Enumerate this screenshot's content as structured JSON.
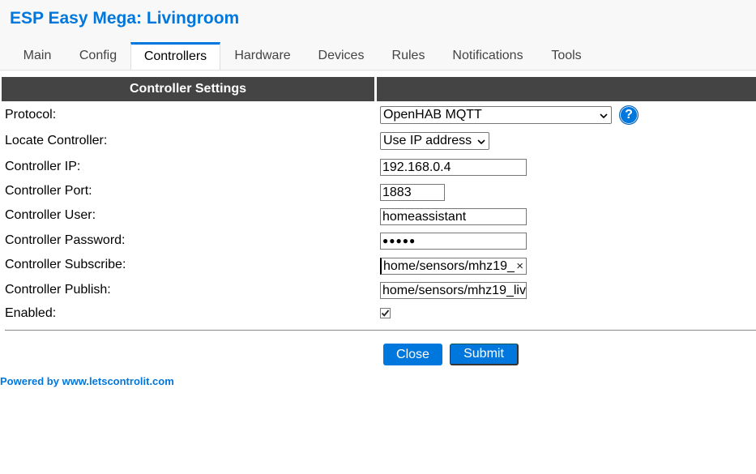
{
  "app": {
    "title": "ESP Easy Mega: Livingroom"
  },
  "tabs": [
    {
      "label": "Main"
    },
    {
      "label": "Config"
    },
    {
      "label": "Controllers",
      "active": true
    },
    {
      "label": "Hardware"
    },
    {
      "label": "Devices"
    },
    {
      "label": "Rules"
    },
    {
      "label": "Notifications"
    },
    {
      "label": "Tools"
    }
  ],
  "form": {
    "header": "Controller Settings",
    "protocol": {
      "label": "Protocol:",
      "value": "OpenHAB MQTT",
      "help_icon": "question-icon"
    },
    "locate": {
      "label": "Locate Controller:",
      "value": "Use IP address"
    },
    "ip": {
      "label": "Controller IP:",
      "value": "192.168.0.4"
    },
    "port": {
      "label": "Controller Port:",
      "value": "1883"
    },
    "user": {
      "label": "Controller User:",
      "value": "homeassistant"
    },
    "password": {
      "label": "Controller Password:",
      "value": "●●●●●"
    },
    "subscribe": {
      "label": "Controller Subscribe:",
      "value": "home/sensors/mhz19_"
    },
    "publish": {
      "label": "Controller Publish:",
      "value": "home/sensors/mhz19_liv"
    },
    "enabled": {
      "label": "Enabled:",
      "checked": true
    }
  },
  "buttons": {
    "close": "Close",
    "submit": "Submit"
  },
  "footer": {
    "powered_by": "Powered by www.letscontrolit.com"
  },
  "colors": {
    "accent": "#0077dd",
    "header_bg": "#444444"
  }
}
